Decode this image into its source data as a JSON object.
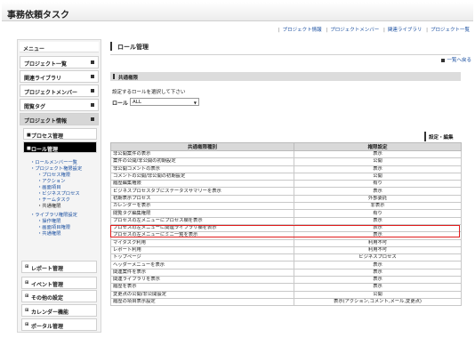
{
  "app": {
    "title": "事務依頼タスク"
  },
  "top_links": [
    "プロジェクト情報",
    "プロジェクトメンバー",
    "関連ライブラリ",
    "プロジェクト一覧"
  ],
  "sidebar": {
    "menu_label": "メニュー",
    "items": [
      {
        "label": "プロジェクト一覧"
      },
      {
        "label": "関連ライブラリ"
      },
      {
        "label": "プロジェクトメンバー"
      },
      {
        "label": "閲覧タグ"
      },
      {
        "label": "プロジェクト情報"
      }
    ],
    "sub_items": [
      {
        "label": "プロセス管理"
      },
      {
        "label": "ロール管理"
      }
    ],
    "tree1": [
      "・ロールメンバー一覧",
      "・プロジェクト権限設定",
      "・プロセス権限",
      "・アクション",
      "・画面項目",
      "・ビジネスプロセス",
      "・チームタスク",
      "・共通権限"
    ],
    "tree2": [
      "・ライブラリ権限設定",
      "・操作権限",
      "・画面項目権限",
      "・共通権限"
    ],
    "bottom_items": [
      {
        "label": "レポート管理"
      },
      {
        "label": "イベント管理"
      },
      {
        "label": "その他の設定"
      },
      {
        "label": "カレンダー機能"
      },
      {
        "label": "ポータル管理"
      }
    ]
  },
  "main": {
    "page_title": "ロール管理",
    "back_link": "一覧へ戻る",
    "section_title": "共通権限",
    "instruction": "設定するロールを選択して下さい",
    "role_label": "ロール",
    "role_value": "ALL",
    "settings_button": "設定・編集",
    "table": {
      "headers": [
        "共通権限種別",
        "権限設定"
      ],
      "rows": [
        [
          "非公開案件の表示",
          "表示"
        ],
        [
          "案件の公開/非公開の初期設定",
          "公開"
        ],
        [
          "非公開コメントの表示",
          "表示"
        ],
        [
          "コメントの公開/非公開の初期設定",
          "公開"
        ],
        [
          "履歴編集権限",
          "有り"
        ],
        [
          "ビジネスプロセスタブにステータスサマリーを表示",
          "表示"
        ],
        [
          "初期表示プロセス",
          "外部委託"
        ],
        [
          "カレンダーを表示",
          "非表示"
        ],
        [
          "閲覧タグ編集権限",
          "有り"
        ],
        [
          "プロセスの左メニューにプロセス欄を表示",
          "表示"
        ],
        [
          "プロセスの左メニューに関連ライブラリ欄を表示",
          "表示"
        ],
        [
          "プロセスの左メニューにミニ一覧を表示",
          "表示"
        ],
        [
          "マイタスク利用",
          "利用不可"
        ],
        [
          "レポート利用",
          "利用不可"
        ],
        [
          "トップページ",
          "ビジネスプロセス"
        ],
        [
          "ヘッダーメニューを表示",
          "表示"
        ],
        [
          "関連案件を表示",
          "表示"
        ],
        [
          "関連ライブラリを表示",
          "表示"
        ],
        [
          "履歴を表示",
          "表示"
        ],
        [
          "変更点の公開/非公開設定",
          "公開"
        ],
        [
          "履歴の項目表示設定",
          "表示(アクション,コメント,メール,変更点)"
        ]
      ]
    }
  },
  "colors": {
    "highlight": "#e01b1b",
    "link": "#1a4fa0",
    "selected_bg": "#000000"
  }
}
